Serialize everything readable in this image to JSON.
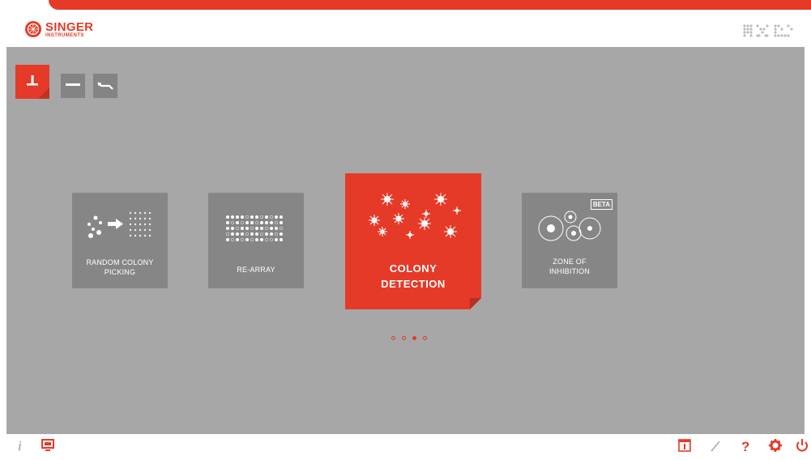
{
  "header": {
    "brand_name": "SINGER",
    "brand_sub": "INSTRUMENTS",
    "device_logo": "HXL"
  },
  "modes": [
    {
      "name": "picking-mode",
      "icon": "pin-tool-icon",
      "active": true
    },
    {
      "name": "plate-mode",
      "icon": "plate-icon",
      "active": false
    },
    {
      "name": "tools-mode",
      "icon": "wrench-icon",
      "active": false
    }
  ],
  "applications": [
    {
      "label": "RANDOM COLONY PICKING",
      "icon": "colony-picking-icon"
    },
    {
      "label": "RE-ARRAY",
      "icon": "grid-array-icon"
    },
    {
      "label": "COLONY DETECTION",
      "icon": "colony-detection-icon",
      "active": true
    },
    {
      "label": "ZONE OF INHIBITION",
      "icon": "zone-inhibition-icon",
      "badge": "BETA"
    }
  ],
  "pager": {
    "count": 4,
    "active_index": 2
  },
  "footer": {
    "left": [
      {
        "icon": "info-icon"
      },
      {
        "icon": "monitor-icon"
      }
    ],
    "right": [
      {
        "icon": "plate-info-icon"
      },
      {
        "icon": "pencil-icon"
      },
      {
        "icon": "help-icon"
      },
      {
        "icon": "settings-icon"
      },
      {
        "icon": "power-icon"
      }
    ]
  },
  "colors": {
    "accent": "#e53a27",
    "background": "#a7a7a7",
    "card": "#868686"
  }
}
